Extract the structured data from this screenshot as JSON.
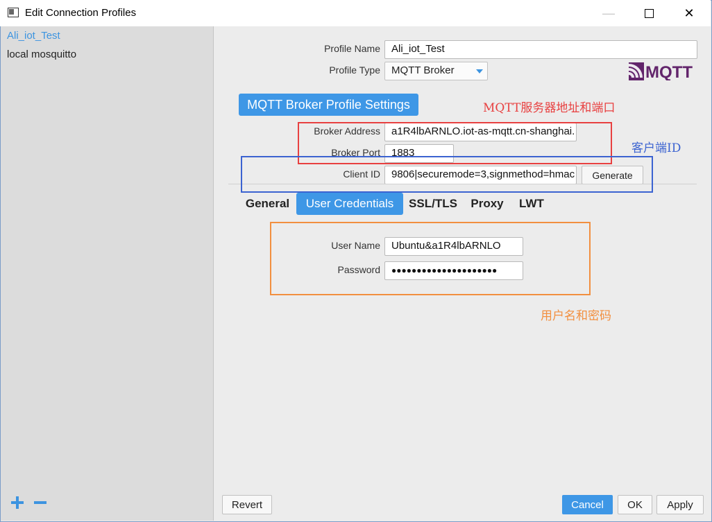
{
  "window": {
    "title": "Edit Connection Profiles"
  },
  "sidebar": {
    "profiles": [
      {
        "label": "Ali_iot_Test",
        "selected": true
      },
      {
        "label": "local mosquitto",
        "selected": false
      }
    ]
  },
  "form": {
    "profile_name_label": "Profile Name",
    "profile_name_value": "Ali_iot_Test",
    "profile_type_label": "Profile Type",
    "profile_type_value": "MQTT Broker",
    "logo_text": "MQTT",
    "section_title": "MQTT Broker Profile Settings",
    "broker_address_label": "Broker Address",
    "broker_address_value": "a1R4lbARNLO.iot-as-mqtt.cn-shanghai.",
    "broker_port_label": "Broker Port",
    "broker_port_value": "1883",
    "client_id_label": "Client ID",
    "client_id_value": "9806|securemode=3,signmethod=hmac",
    "generate_label": "Generate"
  },
  "tabs": [
    {
      "label": "General",
      "active": false
    },
    {
      "label": "User Credentials",
      "active": true
    },
    {
      "label": "SSL/TLS",
      "active": false
    },
    {
      "label": "Proxy",
      "active": false
    },
    {
      "label": "LWT",
      "active": false
    }
  ],
  "credentials": {
    "user_name_label": "User Name",
    "user_name_value": "Ubuntu&a1R4lbARNLO",
    "password_label": "Password",
    "password_value": "●●●●●●●●●●●●●●●●●●●●●"
  },
  "annotations": {
    "broker": "MQTT服务器地址和端口",
    "client": "客户端ID",
    "credentials": "用户名和密码"
  },
  "buttons": {
    "revert": "Revert",
    "cancel": "Cancel",
    "ok": "OK",
    "apply": "Apply"
  },
  "colors": {
    "accent": "#3e97e6",
    "annotation_red": "#e84040",
    "annotation_blue": "#3b63d1",
    "annotation_orange": "#f28f3f"
  }
}
